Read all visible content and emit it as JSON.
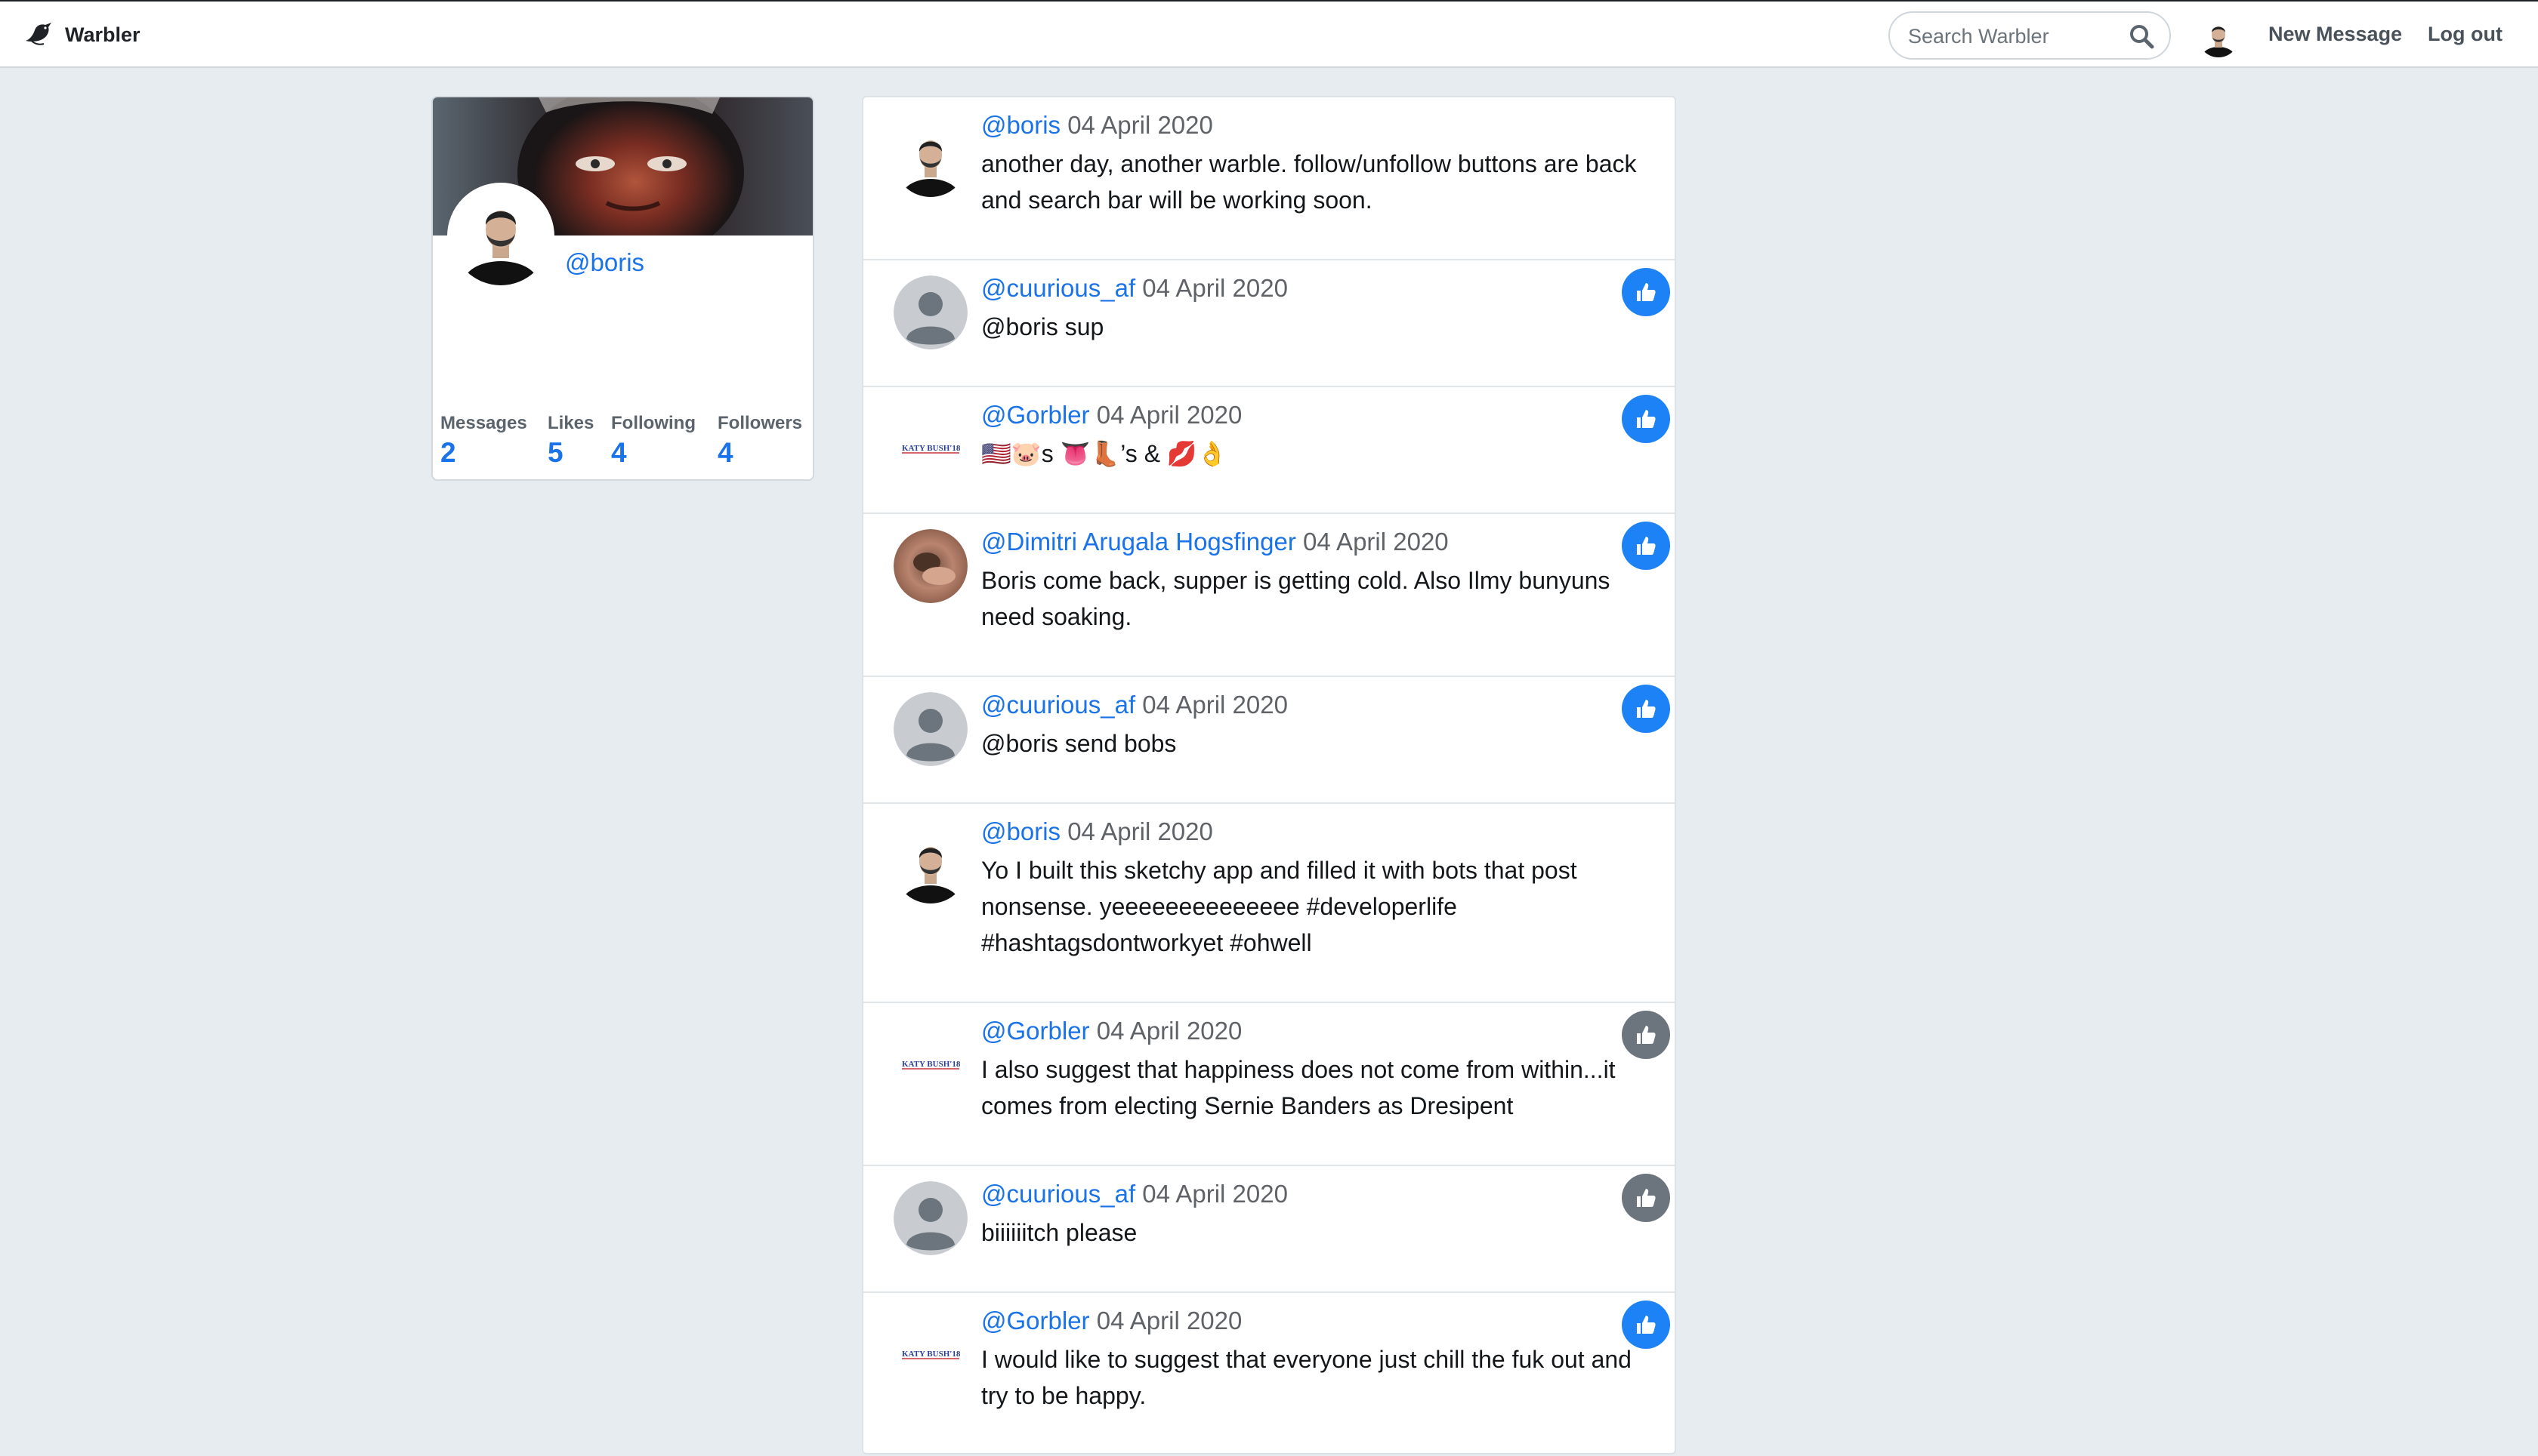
{
  "navbar": {
    "brand": "Warbler",
    "search_placeholder": "Search Warbler",
    "new_message": "New Message",
    "logout": "Log out"
  },
  "profile": {
    "username": "@boris",
    "stats": [
      {
        "label": "Messages",
        "value": "2"
      },
      {
        "label": "Likes",
        "value": "5"
      },
      {
        "label": "Following",
        "value": "4"
      },
      {
        "label": "Followers",
        "value": "4"
      }
    ]
  },
  "messages": [
    {
      "user": "@boris",
      "date": "04 April 2020",
      "text": "another day, another warble. follow/unfollow buttons are back and search bar will be working soon.",
      "avatar": "boris-photo",
      "like": "none"
    },
    {
      "user": "@cuurious_af",
      "date": "04 April 2020",
      "text": "@boris sup",
      "avatar": "default-silhouette",
      "like": "liked"
    },
    {
      "user": "@Gorbler",
      "date": "04 April 2020",
      "text": "🇺🇸🐷s 👅👢’s & 💋👌",
      "avatar": "campaign-logo",
      "like": "liked"
    },
    {
      "user": "@Dimitri Arugala Hogsfinger",
      "date": "04 April 2020",
      "text": "Boris come back, supper is getting cold. Also Ilmy bunyuns need soaking.",
      "avatar": "hands-photo",
      "like": "liked"
    },
    {
      "user": "@cuurious_af",
      "date": "04 April 2020",
      "text": "@boris send bobs",
      "avatar": "default-silhouette",
      "like": "liked"
    },
    {
      "user": "@boris",
      "date": "04 April 2020",
      "text": "Yo I built this sketchy app and filled it with bots that post nonsense. yeeeeeeeeeeeeee #developerlife #hashtagsdontworkyet #ohwell",
      "avatar": "boris-photo",
      "like": "none"
    },
    {
      "user": "@Gorbler",
      "date": "04 April 2020",
      "text": "I also suggest that happiness does not come from within...it comes from electing Sernie Banders as Dresipent",
      "avatar": "campaign-logo",
      "like": "not-liked"
    },
    {
      "user": "@cuurious_af",
      "date": "04 April 2020",
      "text": "biiiiiitch please",
      "avatar": "default-silhouette",
      "like": "not-liked"
    },
    {
      "user": "@Gorbler",
      "date": "04 April 2020",
      "text": "I would like to suggest that everyone just chill the fuk out and try to be happy.",
      "avatar": "campaign-logo",
      "like": "liked"
    }
  ],
  "campaign_logo_text": "KATY BUSH'18",
  "colors": {
    "link": "#1a73e8",
    "like_active": "#1d82f5",
    "like_inactive": "#6c757d",
    "page_bg": "#e6ecf0"
  }
}
